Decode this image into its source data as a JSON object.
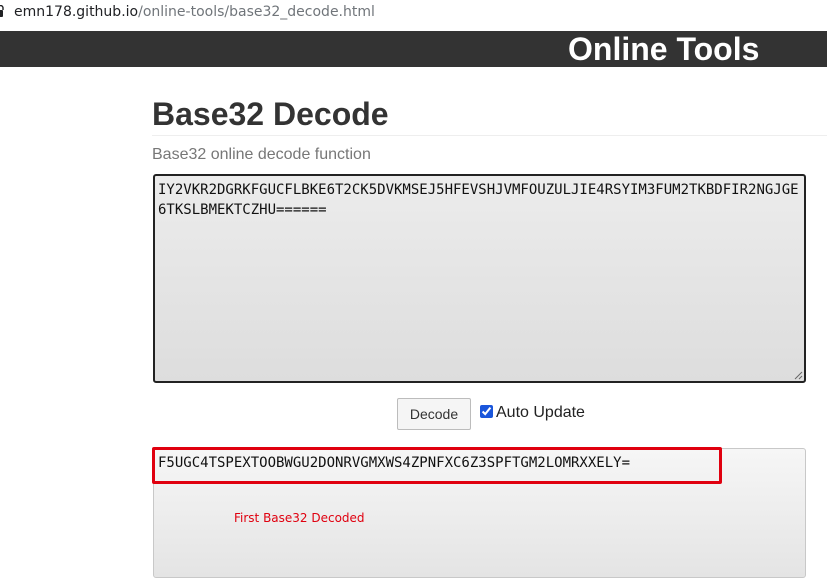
{
  "browser": {
    "url_host": "emn178.github.io",
    "url_path": "/online-tools/base32_decode.html"
  },
  "header": {
    "title": "Online Tools"
  },
  "page": {
    "title": "Base32 Decode",
    "subtitle": "Base32 online decode function"
  },
  "input": {
    "value": "IY2VKR2DGRKFGUCFLBKE6T2CK5DVKMSEJ5HFEVSHJVMFOUZULJIE4RSYIM3FUM2TKBDFIR2NGJGE6TKSLBMEKTCZHU======"
  },
  "controls": {
    "decode_label": "Decode",
    "auto_update_label": "Auto Update",
    "auto_update_checked": true
  },
  "output": {
    "value": "F5UGC4TSPEXTOOBWGU2DONRVGMXWS4ZPNFXC6Z3SPFTGM2LOMRXXELY=",
    "annotation": "First Base32 Decoded",
    "highlight_color": "#e0000f"
  },
  "colors": {
    "header_bg": "#333333",
    "title": "#333333",
    "subtitle": "#777777"
  }
}
